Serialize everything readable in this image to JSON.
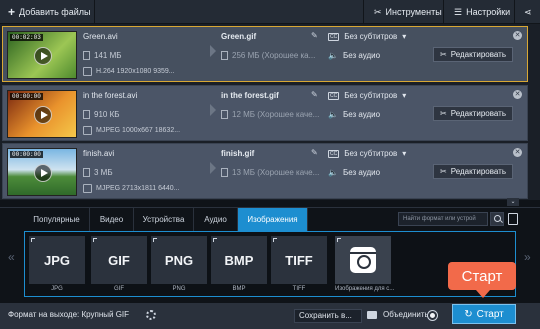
{
  "toolbar": {
    "add_files": "Добавить файлы",
    "tools": "Инструменты",
    "settings": "Настройки"
  },
  "files": [
    {
      "timecode": "00:02:03",
      "name": "Green.avi",
      "size": "141 МБ",
      "info": "H.264 1920x1080 9359...",
      "out_name": "Green.gif",
      "out_size": "256 МБ (Хорошее ка...",
      "subtitles": "Без субтитров",
      "audio": "Без аудио",
      "edit": "Редактировать",
      "thumb_colors": [
        "#3d7a2a",
        "#a7c95a"
      ]
    },
    {
      "timecode": "00:00:00",
      "name": "in the forest.avi",
      "size": "910 КБ",
      "info": "MJPEG 1000x667 18632...",
      "out_name": "in the forest.gif",
      "out_size": "12 МБ (Хорошее каче...",
      "subtitles": "Без субтитров",
      "audio": "Без аудио",
      "edit": "Редактировать",
      "thumb_colors": [
        "#b8461c",
        "#f2b43a"
      ]
    },
    {
      "timecode": "00:00:00",
      "name": "finish.avi",
      "size": "3 МБ",
      "info": "MJPEG 2713x1811 6440...",
      "out_name": "finish.gif",
      "out_size": "13 МБ (Хорошее каче...",
      "subtitles": "Без субтитров",
      "audio": "Без аудио",
      "edit": "Редактировать",
      "thumb_colors": [
        "#6da8d8",
        "#4a8a3a"
      ]
    }
  ],
  "tabs": [
    "Популярные",
    "Видео",
    "Устройства",
    "Аудио",
    "Изображения"
  ],
  "active_tab": "Изображения",
  "search": {
    "placeholder": "Найти формат или устрой"
  },
  "formats": [
    {
      "tile": "JPG",
      "label": "JPG"
    },
    {
      "tile": "GIF",
      "label": "GIF"
    },
    {
      "tile": "PNG",
      "label": "PNG"
    },
    {
      "tile": "BMP",
      "label": "BMP"
    },
    {
      "tile": "TIFF",
      "label": "TIFF"
    },
    {
      "tile": "",
      "label": "Изображения для с...",
      "icon": "instagram-icon"
    }
  ],
  "bottom": {
    "output_format": "Формат на выходе: Крупный GIF",
    "save_to": "Сохранить в...",
    "merge": "Объединить",
    "start": "Старт",
    "callout": "Старт"
  },
  "colors": {
    "accent": "#1d8ed0",
    "selection": "#d9a834",
    "callout": "#f26a4a"
  }
}
